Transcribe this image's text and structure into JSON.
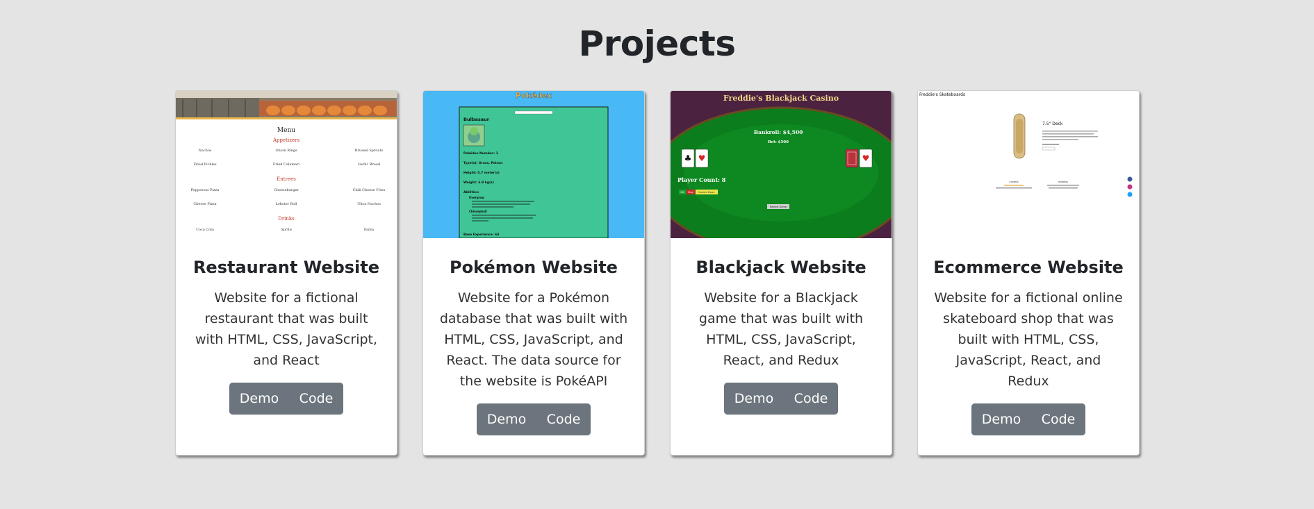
{
  "page": {
    "title": "Projects"
  },
  "projects": [
    {
      "title": "Restaurant Website",
      "description": "Website for a fictional restaurant that was built with HTML, CSS, JavaScript, and React",
      "demo_label": "Demo",
      "code_label": "Code",
      "thumbnail": {
        "heading": "Menu",
        "sections": [
          "Appetizers",
          "Entrees",
          "Drinks"
        ],
        "items": [
          [
            "Nachos",
            "Onion Rings",
            "Brussel Sprouts"
          ],
          [
            "Fried Pickles",
            "Fried Calamari",
            "Garlic Bread"
          ],
          [
            "Pepperoni Pizza",
            "Cheeseburger",
            "Chili Cheese Fries"
          ],
          [
            "Cheese Pizza",
            "Lobster Roll",
            "Ultra Nachos"
          ],
          [
            "Coca Cola",
            "Sprite",
            "Fanta"
          ]
        ]
      }
    },
    {
      "title": "Pokémon Website",
      "description": "Website for a Pokémon database that was built with HTML, CSS, JavaScript, and React. The data source for the website is PokéAPI",
      "demo_label": "Demo",
      "code_label": "Code",
      "thumbnail": {
        "logo": "Pokédex",
        "name": "Bulbasaur",
        "lines": [
          "Pokédex Number: 1",
          "Type(s): Grass, Poison",
          "Height: 0.7 meter(s)",
          "Weight: 6.9 kg(s)",
          "Abilities:",
          "Overgrow",
          "Chlorophyll",
          "Base Experience: 64"
        ]
      }
    },
    {
      "title": "Blackjack Website",
      "description": "Website for a Blackjack game that was built with HTML, CSS, JavaScript, React, and Redux",
      "demo_label": "Demo",
      "code_label": "Code",
      "thumbnail": {
        "heading": "Freddie's Blackjack Casino",
        "bankroll": "Bankroll: $4,500",
        "bet": "Bet: $500",
        "player_count": "Player Count: 8",
        "hit": "Hit",
        "stay": "Stay",
        "double": "Double Down",
        "restart": "Restart Game"
      }
    },
    {
      "title": "Ecommerce Website",
      "description": "Website for a fictional online skateboard shop that was built with HTML, CSS, JavaScript, React, and Redux",
      "demo_label": "Demo",
      "code_label": "Code",
      "thumbnail": {
        "brand": "Freddie's Skateboards",
        "product": "7.5\" Deck",
        "contact": "Contact",
        "address": "Address"
      }
    }
  ],
  "colors": {
    "background": "#e4e4e4",
    "button": "#6c757d",
    "pokemon_sky": "#48b9f5",
    "pokemon_panel": "#40c596",
    "casino_felt": "#0b7d1c",
    "casino_purple": "#4b2340"
  }
}
